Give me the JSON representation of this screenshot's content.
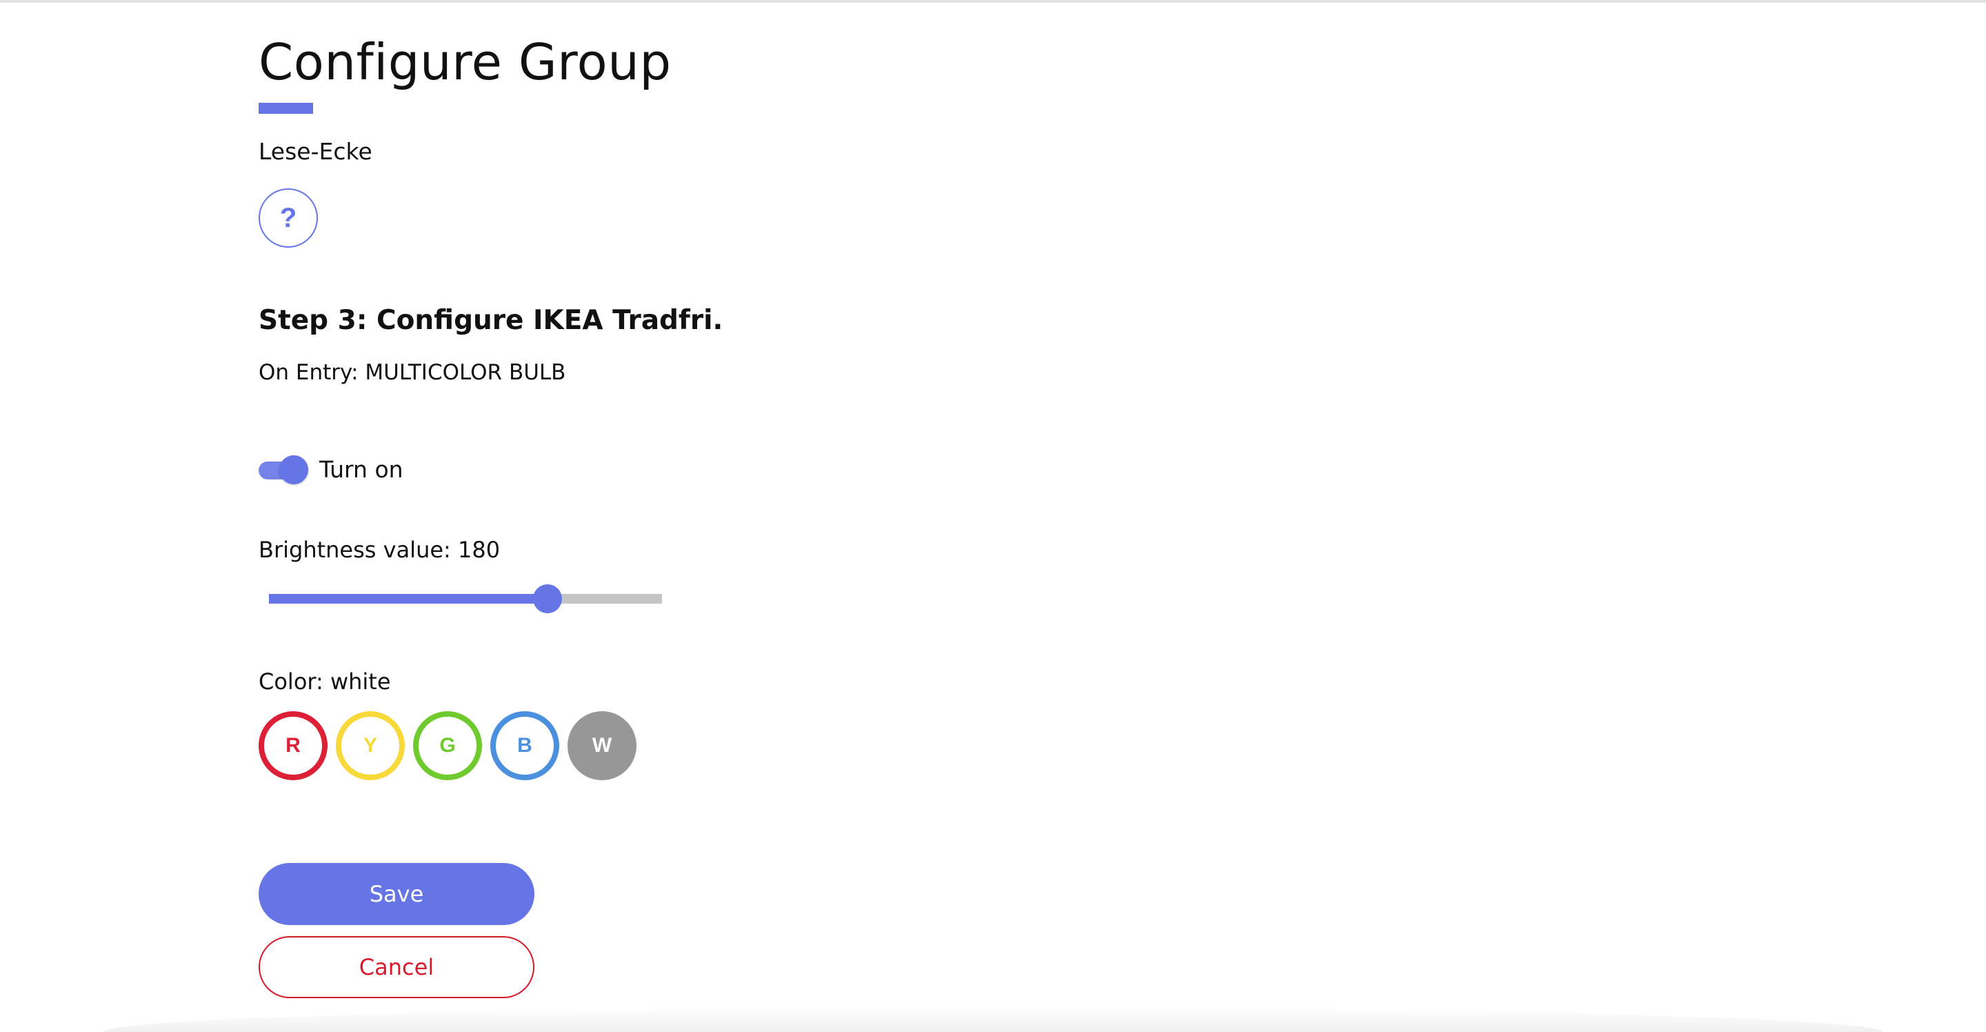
{
  "page": {
    "title": "Configure Group",
    "group_name": "Lese-Ecke",
    "help_glyph": "?",
    "accent_color": "#6675e6",
    "danger_color": "#d91a2b"
  },
  "step": {
    "heading": "Step 3: Configure IKEA Tradfri.",
    "entry_label": "On Entry: MULTICOLOR BULB"
  },
  "toggle": {
    "label": "Turn on",
    "checked": true
  },
  "brightness": {
    "label": "Brightness value: 180",
    "value": 180,
    "min": 0,
    "max": 254
  },
  "color": {
    "label": "Color: white",
    "options": [
      {
        "letter": "R",
        "name": "red",
        "color": "#dc2036",
        "selected": false
      },
      {
        "letter": "Y",
        "name": "yellow",
        "color": "#f7d93a",
        "selected": false
      },
      {
        "letter": "G",
        "name": "green",
        "color": "#6fcb2d",
        "selected": false
      },
      {
        "letter": "B",
        "name": "blue",
        "color": "#4a90de",
        "selected": false
      },
      {
        "letter": "W",
        "name": "white",
        "color": "#979797",
        "selected": true
      }
    ]
  },
  "actions": {
    "save_label": "Save",
    "cancel_label": "Cancel"
  }
}
